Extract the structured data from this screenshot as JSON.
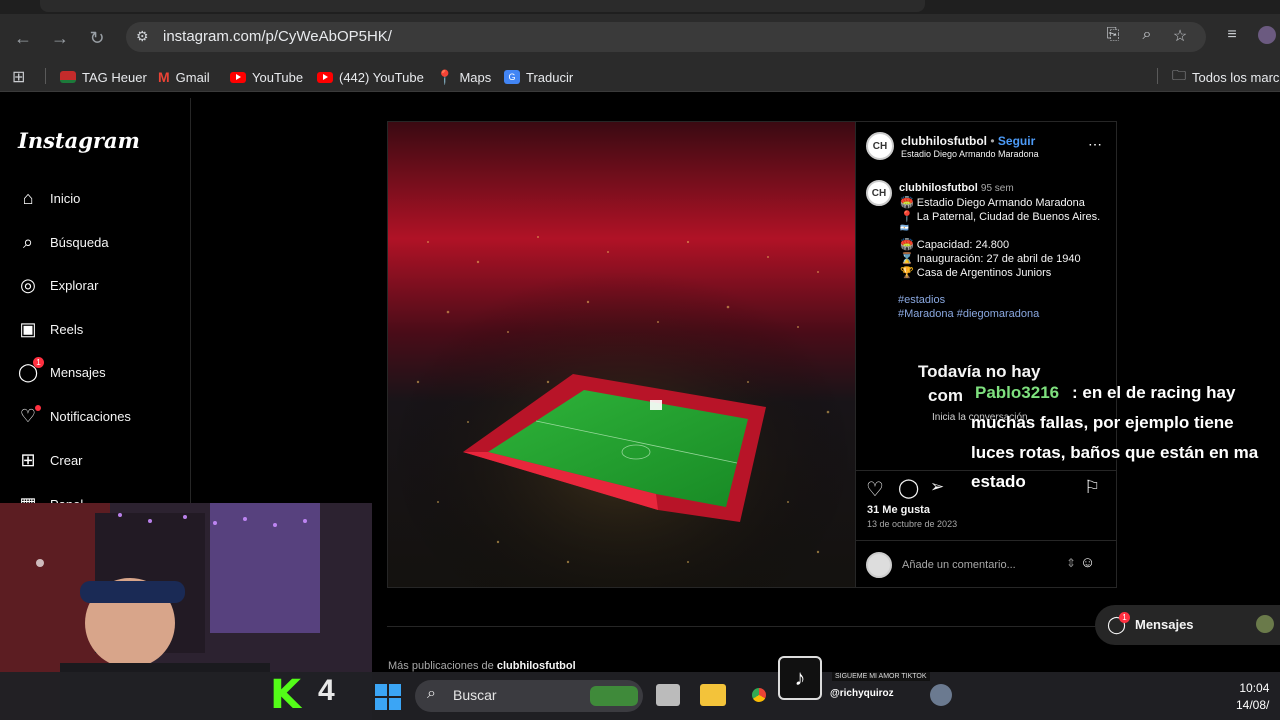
{
  "browser": {
    "url": "instagram.com/p/CyWeAbOP5HK/",
    "bookmarks": [
      {
        "label": "TAG Heuer",
        "color": "#d62e2e"
      },
      {
        "label": "Gmail",
        "color": "#ea4335"
      },
      {
        "label": "YouTube",
        "color": "#ff0000"
      },
      {
        "label": "(442) YouTube",
        "color": "#ff0000"
      },
      {
        "label": "Maps",
        "color": "#34a853"
      },
      {
        "label": "Traducir",
        "color": "#4285f4"
      }
    ],
    "all_bookmarks_label": "Todos los marc"
  },
  "sidebar": {
    "logo": "Instagram",
    "items": [
      {
        "label": "Inicio",
        "icon": "home-icon"
      },
      {
        "label": "Búsqueda",
        "icon": "search-icon"
      },
      {
        "label": "Explorar",
        "icon": "compass-icon"
      },
      {
        "label": "Reels",
        "icon": "reels-icon"
      },
      {
        "label": "Mensajes",
        "icon": "messenger-icon",
        "badge": "1"
      },
      {
        "label": "Notificaciones",
        "icon": "heart-icon"
      },
      {
        "label": "Crear",
        "icon": "plus-square-icon"
      },
      {
        "label": "Panel",
        "icon": "dashboard-icon"
      }
    ]
  },
  "post": {
    "username": "clubhilosfutbol",
    "follow_separator": "•",
    "follow_label": "Seguir",
    "location": "Estadio Diego Armando Maradona",
    "caption_user": "clubhilosfutbol",
    "caption_age": "95 sem",
    "caption_lines": [
      "🏟️ Estadio Diego Armando Maradona",
      "📍 La Paternal, Ciudad de Buenos Aires.",
      "🇦🇷",
      "🏟️ Capacidad:  24.800",
      "⌛ Inauguración: 27 de abril de 1940",
      "🏆 Casa de Argentinos Juniors"
    ],
    "hashtags_line1": "#estadios",
    "hashtags_line2": "#Maradona #diegomaradona",
    "likes": "31 Me gusta",
    "date": "13 de octubre de 2023",
    "comment_placeholder": "Añade un comentario...",
    "no_comments_1": "Todavía no hay",
    "no_comments_2": "com",
    "no_comments_3": "Inicia la conversación"
  },
  "chat_overlay": {
    "user": "Pablo3216",
    "line1": ": en el de racing hay",
    "line2": "muchas fallas, por ejemplo tiene",
    "line3": "luces rotas, baños que están en ma",
    "line4": "estado"
  },
  "more_posts": {
    "prefix": "Más publicaciones de",
    "user": "clubhilosfutbol"
  },
  "messages_pill": {
    "label": "Mensajes",
    "badge": "1"
  },
  "stream": {
    "tiktok_label": "SIGUEME MI AMOR TIKTOK",
    "tiktok_handle": "@richyquiroz",
    "k4": "4"
  },
  "taskbar": {
    "search_label": "Buscar",
    "time": "10:04",
    "date": "14/08/"
  },
  "colors": {
    "accent": "#4d9bf7",
    "badge": "#ff3040",
    "kick_green": "#53fc18"
  }
}
